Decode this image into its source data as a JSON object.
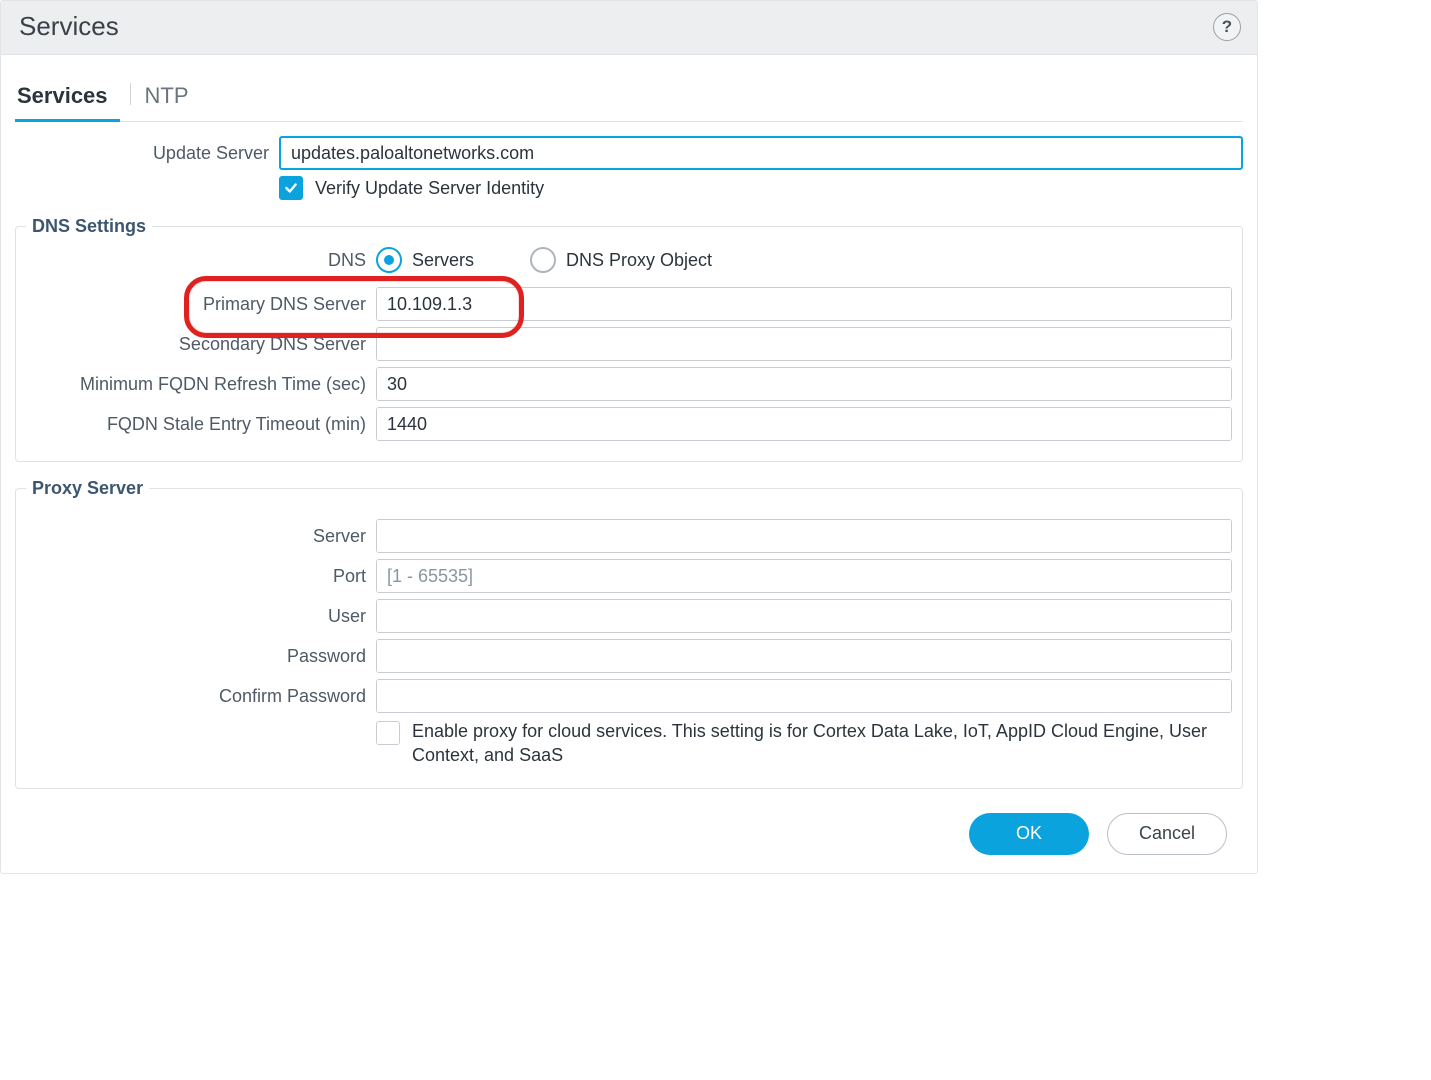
{
  "header": {
    "title": "Services",
    "help_tooltip": "?"
  },
  "tabs": {
    "items": [
      {
        "label": "Services",
        "active": true
      },
      {
        "label": "NTP",
        "active": false
      }
    ]
  },
  "form": {
    "update_server": {
      "label": "Update Server",
      "value": "updates.paloaltonetworks.com"
    },
    "verify_identity": {
      "label": "Verify Update Server Identity",
      "checked": true
    }
  },
  "dns": {
    "legend": "DNS Settings",
    "mode_label": "DNS",
    "options": {
      "servers": "Servers",
      "proxy": "DNS Proxy Object"
    },
    "selected": "servers",
    "primary": {
      "label": "Primary DNS Server",
      "value": "10.109.1.3"
    },
    "secondary": {
      "label": "Secondary DNS Server",
      "value": ""
    },
    "min_fqdn_refresh": {
      "label": "Minimum FQDN Refresh Time (sec)",
      "value": "30"
    },
    "fqdn_stale_timeout": {
      "label": "FQDN Stale Entry Timeout (min)",
      "value": "1440"
    }
  },
  "proxy": {
    "legend": "Proxy Server",
    "server": {
      "label": "Server",
      "value": ""
    },
    "port": {
      "label": "Port",
      "value": "",
      "placeholder": "[1 - 65535]"
    },
    "user": {
      "label": "User",
      "value": ""
    },
    "password": {
      "label": "Password",
      "value": ""
    },
    "confirm_password": {
      "label": "Confirm Password",
      "value": ""
    },
    "enable_cloud": {
      "label": "Enable proxy for cloud services. This setting is for Cortex Data Lake, IoT, AppID Cloud Engine, User Context, and SaaS",
      "checked": false
    }
  },
  "footer": {
    "ok": "OK",
    "cancel": "Cancel"
  },
  "colors": {
    "brand": "#0aa3de",
    "highlight": "#e0211f"
  }
}
